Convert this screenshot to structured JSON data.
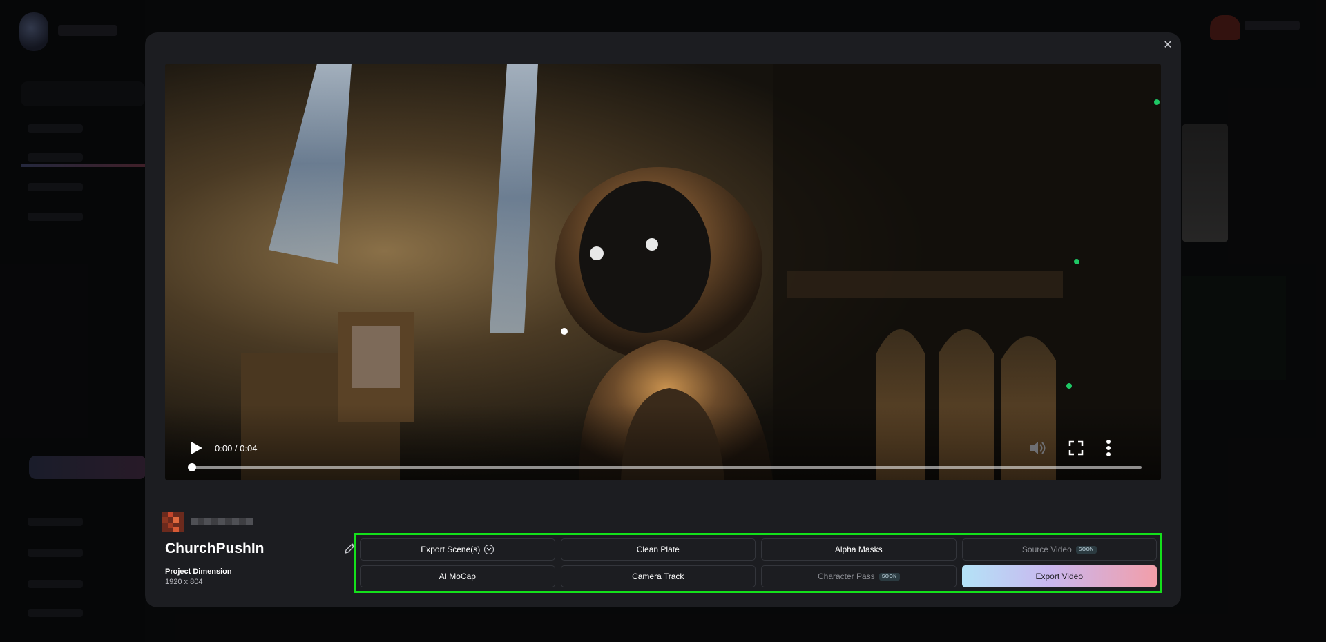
{
  "video": {
    "time": "0:00 / 0:04",
    "progress": 0
  },
  "project": {
    "title": "ChurchPushIn",
    "dimension_label": "Project Dimension",
    "dimension_value": "1920 x 804"
  },
  "actions": {
    "export_scenes": "Export Scene(s)",
    "clean_plate": "Clean Plate",
    "alpha_masks": "Alpha Masks",
    "source_video": "Source Video",
    "source_video_badge": "SOON",
    "ai_mocap": "AI MoCap",
    "camera_track": "Camera Track",
    "character_pass": "Character Pass",
    "character_pass_badge": "SOON",
    "export_video": "Export Video"
  },
  "colors": {
    "highlight": "#14e01b",
    "export_gradient": [
      "#b4e3f7",
      "#c9b7ef",
      "#f29ea9"
    ]
  },
  "icons": {
    "close": "close-icon",
    "play": "play-icon",
    "volume": "volume-muted-icon",
    "fullscreen": "fullscreen-icon",
    "more": "more-vertical-icon",
    "edit": "pencil-icon",
    "dropdown": "chevron-down-circle-icon"
  }
}
